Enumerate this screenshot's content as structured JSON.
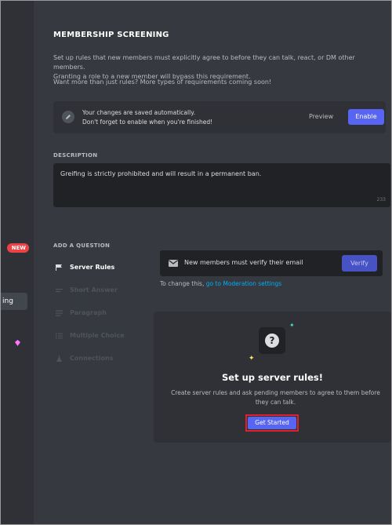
{
  "sidebar": {
    "new_badge": "NEW",
    "active_item_label": "ing"
  },
  "page": {
    "title": "MEMBERSHIP SCREENING",
    "intro_line1": "Set up rules that new members must explicitly agree to before they can talk, react, or DM other members.",
    "intro_line2": "Granting a role to a new member will bypass this requirement.",
    "subtext": "Want more than just rules? More types of requirements coming soon!"
  },
  "notice": {
    "line1": "Your changes are saved automatically.",
    "line2": "Don't forget to enable when you're finished!",
    "preview_label": "Preview",
    "enable_label": "Enable"
  },
  "description": {
    "label": "DESCRIPTION",
    "value": "Greifing is strictly prohibited and will result in a permanent ban.",
    "remaining": "233"
  },
  "questions": {
    "label": "ADD A QUESTION",
    "items": [
      {
        "label": "Server Rules",
        "icon": "flag-icon"
      },
      {
        "label": "Short Answer",
        "icon": "short-answer-icon"
      },
      {
        "label": "Paragraph",
        "icon": "paragraph-icon"
      },
      {
        "label": "Multiple Choice",
        "icon": "list-icon"
      },
      {
        "label": "Connections",
        "icon": "connections-icon"
      }
    ]
  },
  "verify": {
    "text": "New members must verify their email",
    "button_label": "Verify",
    "hint_prefix": "To change this, ",
    "hint_link": "go to Moderation settings"
  },
  "rules_panel": {
    "title": "Set up server rules!",
    "description": "Create server rules and ask pending members to agree to them before they can talk.",
    "button_label": "Get Started",
    "icon": "question-icon"
  },
  "colors": {
    "background": "#36393f",
    "panel": "#2f3136",
    "input": "#202225",
    "accent": "#5865f2",
    "link": "#00aff4",
    "danger": "#ed4245",
    "highlight_border": "#e0202c"
  }
}
